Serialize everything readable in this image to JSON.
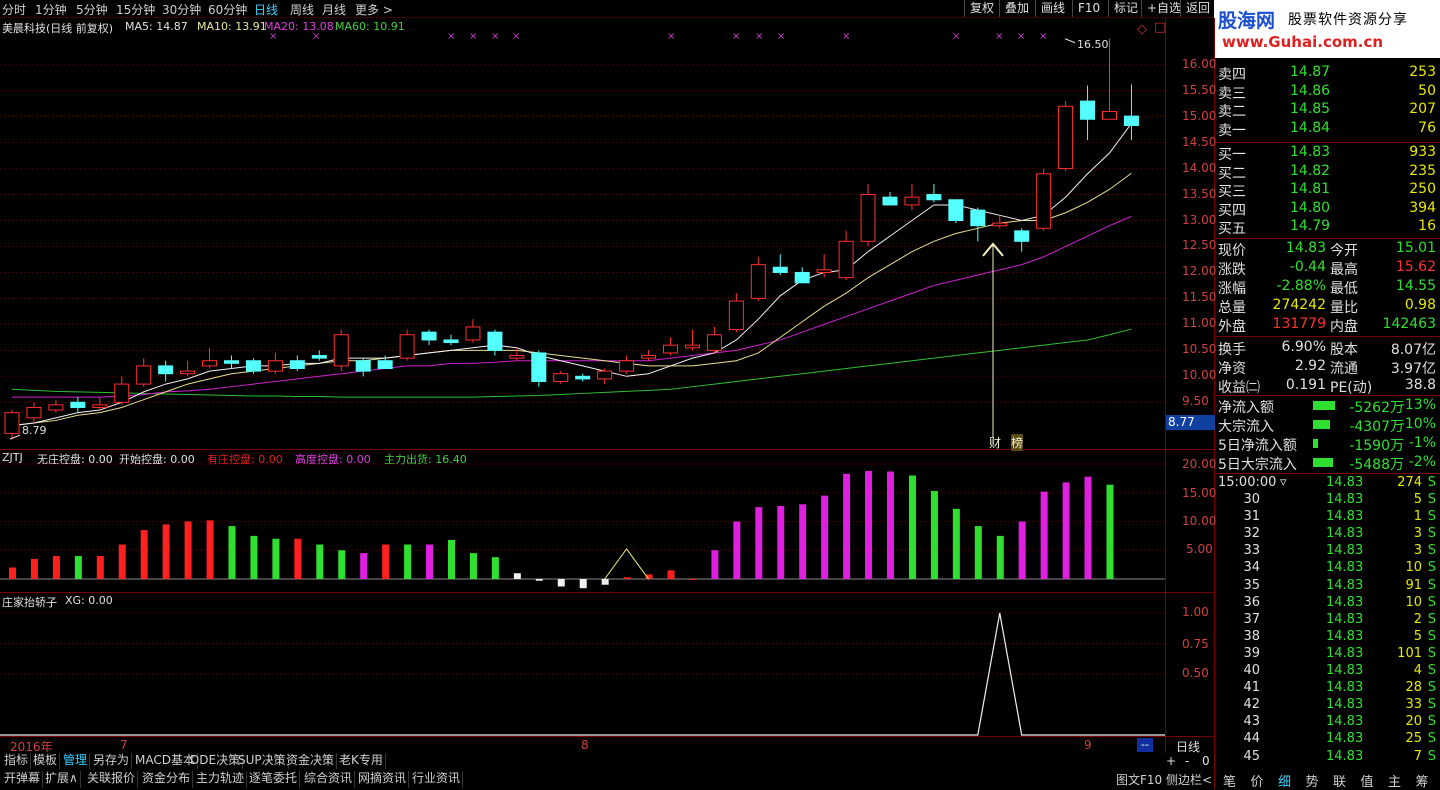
{
  "periods": [
    "分时",
    "1分钟",
    "5分钟",
    "15分钟",
    "30分钟",
    "60分钟",
    "日线",
    "周线",
    "月线",
    "更多 >"
  ],
  "tools": [
    "复权",
    "叠加",
    "画线",
    "F10",
    "标记",
    "+自选",
    "返回"
  ],
  "logo": {
    "cn": "股海网",
    "slogan": "股票软件资源分享",
    "url": "www.Guhai.com.cn"
  },
  "main_legend": {
    "title": "美晨科技(日线 前复权)",
    "ma5": "MA5: 14.87",
    "ma10": "MA10: 13.91",
    "ma20": "MA20: 13.08",
    "ma60": "MA60: 10.91"
  },
  "price_axis": [
    "16.00",
    "15.50",
    "15.00",
    "14.50",
    "14.00",
    "13.50",
    "13.00",
    "12.50",
    "12.00",
    "11.50",
    "11.00",
    "10.50",
    "10.00",
    "9.50"
  ],
  "current_price_tag": "8.77",
  "high_mark": "16.50",
  "low_mark": "8.79",
  "annotation": {
    "a": "财",
    "b": "榜"
  },
  "ind1": {
    "name": "ZJTJ",
    "l1": "无庄控盘: 0.00",
    "l2": "开始控盘: 0.00",
    "l3": "有庄控盘: 0.00",
    "l4": "高度控盘: 0.00",
    "l5": "主力出货: 16.40",
    "axis": [
      "20.00",
      "15.00",
      "10.00",
      "5.00"
    ]
  },
  "ind2": {
    "name": "庄家抬轿子",
    "xg": "XG: 0.00",
    "axis": [
      "1.00",
      "0.75",
      "0.50"
    ]
  },
  "time_axis": {
    "a": "2016年",
    "b": "7",
    "c": "8",
    "d": "9"
  },
  "period_label": "日线",
  "zoom": [
    "+",
    "-",
    "0"
  ],
  "dash": "--",
  "bottom_tabs1": [
    "指标",
    "模板",
    "管理",
    "另存为",
    "MACD基本",
    "DDE决策",
    "SUP决策",
    "资金决策",
    "老K专用"
  ],
  "bottom_tabs2": [
    "开弹幕",
    "扩展∧",
    "关联报价",
    "资金分布",
    "主力轨迹",
    "逐笔委托",
    "综合资讯",
    "网摘资讯",
    "行业资讯"
  ],
  "bottom_right": {
    "btn1": "图文F10",
    "btn2": "侧边栏<"
  },
  "side_tabs": [
    "笔",
    "价",
    "细",
    "势",
    "联",
    "值",
    "主",
    "筹"
  ],
  "asks": [
    [
      "卖四",
      "14.87",
      "253"
    ],
    [
      "卖三",
      "14.86",
      "50"
    ],
    [
      "卖二",
      "14.85",
      "207"
    ],
    [
      "卖一",
      "14.84",
      "76"
    ]
  ],
  "bids": [
    [
      "买一",
      "14.83",
      "933"
    ],
    [
      "买二",
      "14.82",
      "235"
    ],
    [
      "买三",
      "14.81",
      "250"
    ],
    [
      "买四",
      "14.80",
      "394"
    ],
    [
      "买五",
      "14.79",
      "16"
    ]
  ],
  "quote": [
    [
      "现价",
      "14.83",
      "今开",
      "15.01"
    ],
    [
      "涨跌",
      "-0.44",
      "最高",
      "15.62"
    ],
    [
      "涨幅",
      "-2.88%",
      "最低",
      "14.55"
    ],
    [
      "总量",
      "274242",
      "量比",
      "0.98"
    ],
    [
      "外盘",
      "131779",
      "内盘",
      "142463"
    ],
    [
      "换手",
      "6.90%",
      "股本",
      "8.07亿"
    ],
    [
      "净资",
      "2.92",
      "流通",
      "3.97亿"
    ],
    [
      "收益㈡",
      "0.191",
      "PE(动)",
      "38.8"
    ]
  ],
  "flows": [
    {
      "label": "净流入额",
      "val": "-5262万",
      "pct": "-13%",
      "w": 0.62
    },
    {
      "label": "大宗流入",
      "val": "-4307万",
      "pct": "-10%",
      "w": 0.48
    },
    {
      "label": "5日净流入额",
      "val": "-1590万",
      "pct": "-1%",
      "w": 0.15
    },
    {
      "label": "5日大宗流入",
      "val": "-5488万",
      "pct": "-2%",
      "w": 0.55
    }
  ],
  "ticks_head": {
    "time": "15:00:00",
    "arrow": "▿",
    "price": "14.83",
    "vol": "274",
    "side": "S"
  },
  "ticks": [
    [
      "30",
      "14.83",
      "5",
      "S"
    ],
    [
      "31",
      "14.83",
      "1",
      "S"
    ],
    [
      "32",
      "14.83",
      "3",
      "S"
    ],
    [
      "33",
      "14.83",
      "3",
      "S"
    ],
    [
      "34",
      "14.83",
      "10",
      "S"
    ],
    [
      "35",
      "14.83",
      "91",
      "S"
    ],
    [
      "36",
      "14.83",
      "10",
      "S"
    ],
    [
      "37",
      "14.83",
      "2",
      "S"
    ],
    [
      "38",
      "14.83",
      "5",
      "S"
    ],
    [
      "39",
      "14.83",
      "101",
      "S"
    ],
    [
      "40",
      "14.83",
      "4",
      "S"
    ],
    [
      "41",
      "14.83",
      "28",
      "S"
    ],
    [
      "42",
      "14.83",
      "33",
      "S"
    ],
    [
      "43",
      "14.83",
      "20",
      "S"
    ],
    [
      "44",
      "14.83",
      "25",
      "S"
    ],
    [
      "45",
      "14.83",
      "7",
      "S"
    ]
  ],
  "chart_data": {
    "type": "candlestick",
    "candles": [
      [
        8.9,
        9.3,
        9.35,
        8.79
      ],
      [
        9.2,
        9.4,
        9.5,
        9.1
      ],
      [
        9.35,
        9.45,
        9.55,
        9.3
      ],
      [
        9.5,
        9.4,
        9.6,
        9.3
      ],
      [
        9.4,
        9.45,
        9.6,
        9.35
      ],
      [
        9.5,
        9.85,
        10.0,
        9.45
      ],
      [
        9.85,
        10.2,
        10.35,
        9.8
      ],
      [
        10.2,
        10.05,
        10.3,
        9.9
      ],
      [
        10.05,
        10.1,
        10.3,
        10.0
      ],
      [
        10.2,
        10.3,
        10.55,
        10.15
      ],
      [
        10.3,
        10.25,
        10.4,
        10.15
      ],
      [
        10.3,
        10.1,
        10.35,
        10.05
      ],
      [
        10.1,
        10.3,
        10.45,
        10.05
      ],
      [
        10.3,
        10.15,
        10.4,
        10.1
      ],
      [
        10.4,
        10.35,
        10.5,
        10.3
      ],
      [
        10.2,
        10.8,
        10.9,
        10.1
      ],
      [
        10.3,
        10.1,
        10.35,
        10.0
      ],
      [
        10.3,
        10.15,
        10.4,
        10.25
      ],
      [
        10.35,
        10.8,
        10.9,
        10.3
      ],
      [
        10.85,
        10.7,
        10.9,
        10.6
      ],
      [
        10.7,
        10.65,
        10.8,
        10.6
      ],
      [
        10.7,
        10.95,
        11.1,
        10.65
      ],
      [
        10.85,
        10.5,
        10.9,
        10.4
      ],
      [
        10.35,
        10.4,
        10.55,
        10.3
      ],
      [
        10.45,
        9.9,
        10.5,
        9.8
      ],
      [
        9.9,
        10.05,
        10.1,
        9.85
      ],
      [
        10.0,
        9.95,
        10.05,
        9.9
      ],
      [
        9.95,
        10.1,
        10.15,
        9.85
      ],
      [
        10.1,
        10.3,
        10.4,
        10.05
      ],
      [
        10.35,
        10.4,
        10.5,
        10.3
      ],
      [
        10.45,
        10.6,
        10.75,
        10.4
      ],
      [
        10.55,
        10.6,
        10.9,
        10.5
      ],
      [
        10.5,
        10.8,
        10.95,
        10.45
      ],
      [
        10.9,
        11.45,
        11.6,
        10.85
      ],
      [
        11.5,
        12.15,
        12.3,
        11.45
      ],
      [
        12.1,
        12.0,
        12.35,
        11.95
      ],
      [
        12.0,
        11.8,
        12.1,
        11.8
      ],
      [
        12.0,
        12.05,
        12.35,
        11.9
      ],
      [
        11.9,
        12.6,
        12.8,
        11.85
      ],
      [
        12.6,
        13.5,
        13.7,
        12.5
      ],
      [
        13.45,
        13.3,
        13.55,
        13.3
      ],
      [
        13.3,
        13.45,
        13.7,
        13.2
      ],
      [
        13.5,
        13.4,
        13.7,
        13.35
      ],
      [
        13.4,
        13.0,
        13.4,
        12.95
      ],
      [
        13.2,
        12.9,
        13.25,
        12.6
      ],
      [
        12.9,
        12.95,
        13.1,
        12.85
      ],
      [
        12.8,
        12.6,
        12.85,
        12.4
      ],
      [
        12.85,
        13.9,
        14.0,
        12.8
      ],
      [
        14.0,
        15.2,
        15.3,
        13.95
      ],
      [
        15.3,
        14.95,
        15.6,
        14.55
      ],
      [
        14.95,
        15.1,
        16.5,
        14.95
      ],
      [
        15.01,
        14.83,
        15.62,
        14.55
      ]
    ],
    "ma5": [
      9.05,
      9.1,
      9.2,
      9.3,
      9.35,
      9.5,
      9.7,
      9.85,
      9.95,
      10.1,
      10.15,
      10.2,
      10.2,
      10.25,
      10.25,
      10.35,
      10.35,
      10.35,
      10.4,
      10.45,
      10.5,
      10.55,
      10.6,
      10.55,
      10.4,
      10.3,
      10.2,
      10.1,
      10.0,
      10.05,
      10.2,
      10.35,
      10.45,
      10.7,
      11.1,
      11.55,
      11.85,
      12.0,
      12.05,
      12.4,
      12.7,
      13.0,
      13.3,
      13.3,
      13.2,
      13.1,
      13.0,
      13.1,
      13.45,
      13.9,
      14.3,
      14.87
    ],
    "ma10": [
      9.05,
      9.1,
      9.15,
      9.25,
      9.3,
      9.4,
      9.55,
      9.7,
      9.85,
      9.95,
      10.05,
      10.1,
      10.15,
      10.2,
      10.25,
      10.3,
      10.3,
      10.35,
      10.4,
      10.45,
      10.5,
      10.5,
      10.5,
      10.5,
      10.45,
      10.4,
      10.35,
      10.3,
      10.25,
      10.2,
      10.2,
      10.2,
      10.25,
      10.3,
      10.45,
      10.75,
      11.05,
      11.35,
      11.6,
      11.9,
      12.15,
      12.4,
      12.6,
      12.75,
      12.85,
      12.95,
      13.0,
      13.0,
      13.15,
      13.35,
      13.6,
      13.91
    ],
    "ma20": [
      9.6,
      9.6,
      9.6,
      9.6,
      9.6,
      9.62,
      9.65,
      9.7,
      9.72,
      9.75,
      9.8,
      9.85,
      9.9,
      9.95,
      10.0,
      10.05,
      10.1,
      10.15,
      10.2,
      10.2,
      10.25,
      10.25,
      10.27,
      10.3,
      10.3,
      10.3,
      10.3,
      10.3,
      10.3,
      10.3,
      10.35,
      10.4,
      10.45,
      10.5,
      10.6,
      10.7,
      10.85,
      11.0,
      11.15,
      11.3,
      11.45,
      11.6,
      11.75,
      11.85,
      11.95,
      12.05,
      12.15,
      12.3,
      12.5,
      12.7,
      12.9,
      13.08
    ],
    "ma60": [
      9.75,
      9.73,
      9.71,
      9.7,
      9.69,
      9.68,
      9.67,
      9.66,
      9.65,
      9.64,
      9.63,
      9.62,
      9.62,
      9.61,
      9.61,
      9.6,
      9.6,
      9.6,
      9.6,
      9.6,
      9.6,
      9.6,
      9.61,
      9.62,
      9.63,
      9.65,
      9.67,
      9.69,
      9.71,
      9.73,
      9.75,
      9.8,
      9.85,
      9.9,
      9.95,
      10.0,
      10.05,
      10.1,
      10.15,
      10.2,
      10.25,
      10.3,
      10.35,
      10.4,
      10.45,
      10.5,
      10.55,
      10.6,
      10.65,
      10.7,
      10.8,
      10.91
    ],
    "ind1_values": [
      2,
      3.5,
      4,
      4,
      4,
      6,
      8.5,
      9.5,
      10,
      10.2,
      9.2,
      7.5,
      7,
      7,
      6,
      5,
      4.5,
      6,
      6,
      6,
      6.8,
      4.5,
      3.8,
      1,
      -0.3,
      -1.3,
      -1.6,
      -1,
      0.3,
      0.8,
      1.5,
      0,
      5,
      10,
      12.5,
      12.7,
      13,
      14.5,
      18.3,
      18.8,
      18.7,
      18,
      15.3,
      12.2,
      9.2,
      7.5,
      10,
      15.2,
      16.8,
      17.8,
      16.4
    ],
    "ind1_colors": [
      "r",
      "r",
      "r",
      "g",
      "r",
      "r",
      "r",
      "r",
      "r",
      "r",
      "g",
      "g",
      "g",
      "r",
      "g",
      "g",
      "m",
      "r",
      "g",
      "m",
      "g",
      "g",
      "g",
      "w",
      "w",
      "w",
      "w",
      "w",
      "r",
      "r",
      "r",
      "r",
      "m",
      "m",
      "m",
      "m",
      "m",
      "m",
      "m",
      "m",
      "m",
      "g",
      "g",
      "g",
      "g",
      "g",
      "m",
      "m",
      "m",
      "m",
      "g"
    ],
    "ind2_peak_index": 45,
    "ylim": [
      8.6,
      16.9
    ]
  }
}
